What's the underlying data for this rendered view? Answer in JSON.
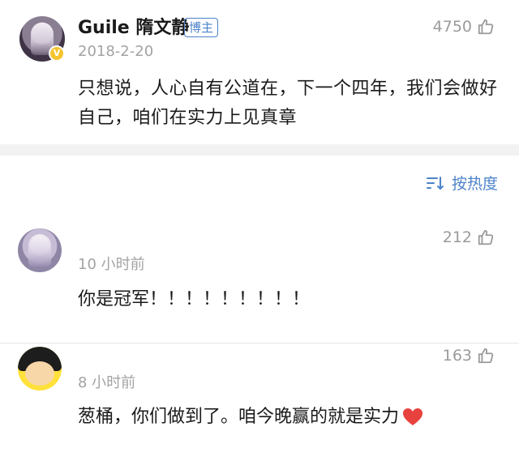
{
  "post": {
    "username": "Guile 隋文静",
    "badge": "博主",
    "verified_badge": "V",
    "date": "2018-2-20",
    "like_count": "4750",
    "text": "只想说，人心自有公道在，下一个四年，我们会做好自己，咱们在实力上见真章"
  },
  "sort": {
    "label": "按热度",
    "icon": "sort-icon"
  },
  "comments": [
    {
      "time": "10 小时前",
      "like_count": "212",
      "text": "你是冠军！！！！！！！！！"
    },
    {
      "time": "8 小时前",
      "like_count": "163",
      "text": "葱桶，你们做到了。咱今晚赢的就是实力",
      "emoji": "heart-emoji"
    }
  ],
  "colors": {
    "accent": "#4d82c9",
    "meta_text": "#a3a3a3",
    "divider_band": "#f2f2f2",
    "verified": "#f6c42f",
    "heart": "#e8423f"
  }
}
